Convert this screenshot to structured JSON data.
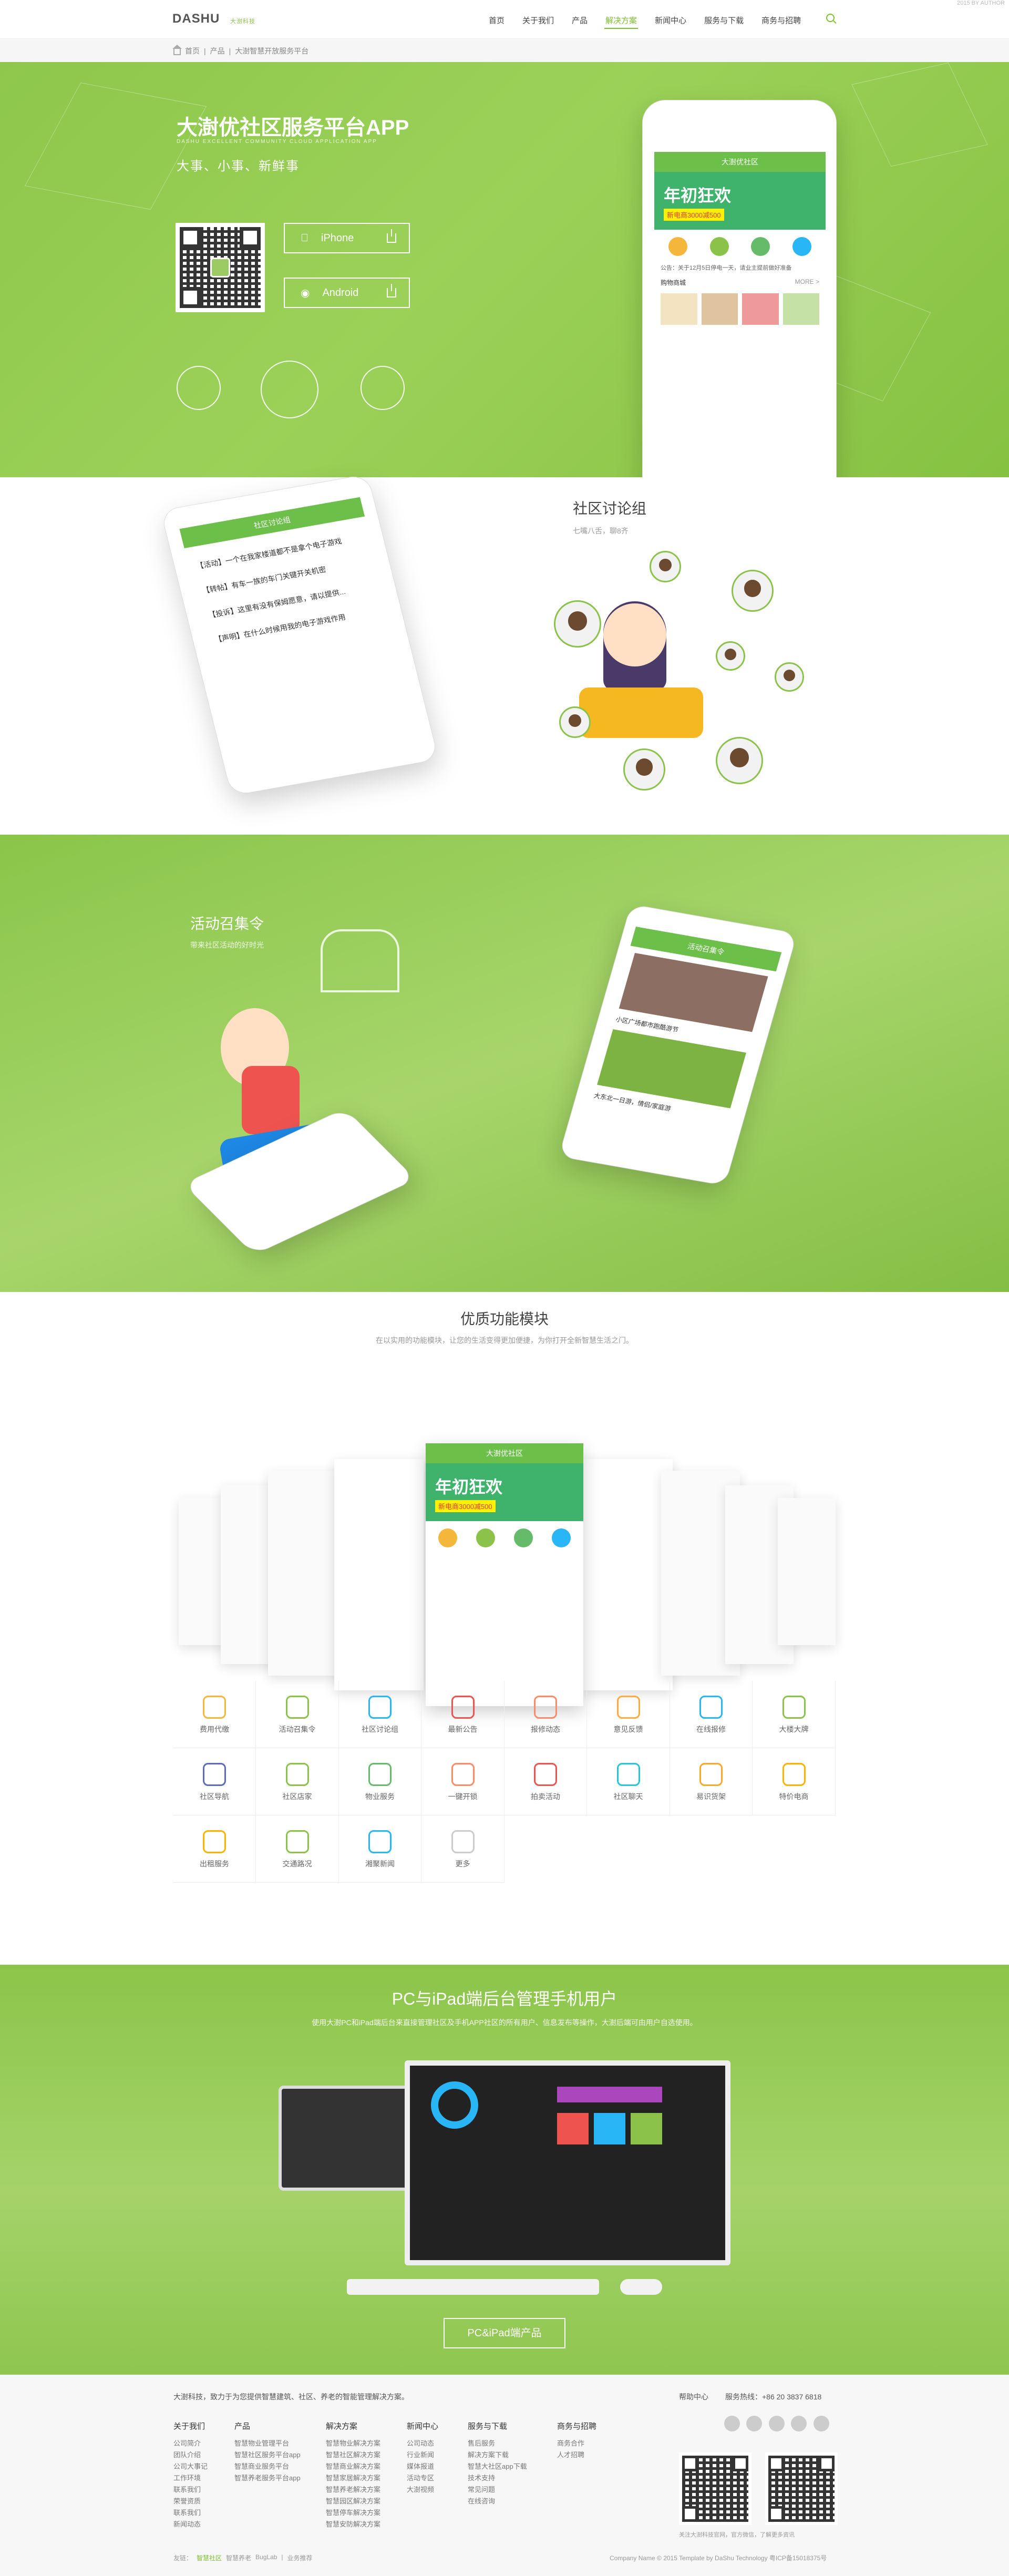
{
  "header": {
    "logo": "DASHU",
    "logo_sub": "DASHU",
    "logo_tag": "大澍科技",
    "nav": [
      "首页",
      "关于我们",
      "产品",
      "解决方案",
      "新闻中心",
      "服务与下载",
      "商务与招聘"
    ],
    "active_index": 3,
    "top_right": "2015 BY AUTHOR"
  },
  "breadcrumb": [
    "首页",
    "产品",
    "大澍智慧开放服务平台"
  ],
  "hero": {
    "title": "大澍优社区服务平台APP",
    "en": "DASHU EXCELLENT COMMUNITY CLOUD APPLICATION APP",
    "subtitle": "大事、小事、新鲜事",
    "iphone_label": "iPhone",
    "android_label": "Android",
    "phone": {
      "app_title": "大澍优社区",
      "banner_big": "年初狂欢",
      "banner_coupon": "新电商3000减500",
      "notice": "公告：关于12月5日停电一天，请业主提前做好准备",
      "shop_title": "购物商城",
      "more": "MORE >"
    }
  },
  "community": {
    "title": "社区讨论组",
    "subtitle": "七嘴八舌，聊8齐",
    "list_title": "社区讨论组",
    "posts": [
      "【活动】一个在我家楼道都不是拿个电子游戏",
      "【转帖】有车一族的车门关键开关机密",
      "【投诉】这里有没有保姆愿意，请以提供...",
      "【声明】在什么时候用我的电子游戏作用"
    ]
  },
  "activity": {
    "title": "活动召集令",
    "subtitle": "带来社区活动的好时光",
    "card_titles": [
      "小区广场都市跑酷游节",
      "大东北一日游，情侣/家庭游"
    ]
  },
  "modules": {
    "title": "优质功能模块",
    "subtitle": "在以实用的功能模块，让您的生活变得更加便捷，为你打开全新智慧生活之门。",
    "items": [
      {
        "label": "费用代缴",
        "icon": "coin-icon",
        "color": "#f5b73b"
      },
      {
        "label": "活动召集令",
        "icon": "flag-icon",
        "color": "#8bc34a"
      },
      {
        "label": "社区讨论组",
        "icon": "chat-icon",
        "color": "#29b6f6"
      },
      {
        "label": "最新公告",
        "icon": "megaphone-icon",
        "color": "#ef5350"
      },
      {
        "label": "报修动态",
        "icon": "eye-icon",
        "color": "#ff8a65"
      },
      {
        "label": "意见反馈",
        "icon": "mail-icon",
        "color": "#ffab40"
      },
      {
        "label": "在线报修",
        "icon": "tools-icon",
        "color": "#29b6f6"
      },
      {
        "label": "大楼大牌",
        "icon": "building-icon",
        "color": "#8bc34a"
      },
      {
        "label": "社区导航",
        "icon": "signpost-icon",
        "color": "#5c6bc0"
      },
      {
        "label": "社区店家",
        "icon": "shop-icon",
        "color": "#8bc34a"
      },
      {
        "label": "物业服务",
        "icon": "house-icon",
        "color": "#66bb6a"
      },
      {
        "label": "一键开锁",
        "icon": "hand-icon",
        "color": "#ff8a65"
      },
      {
        "label": "拍卖活动",
        "icon": "hammer-icon",
        "color": "#ef5350"
      },
      {
        "label": "社区聊天",
        "icon": "chat-bubbles-icon",
        "color": "#26c6da"
      },
      {
        "label": "易识货架",
        "icon": "bag-icon",
        "color": "#ffa726"
      },
      {
        "label": "特价电商",
        "icon": "cart-icon",
        "color": "#ffb300"
      },
      {
        "label": "出租服务",
        "icon": "bus-icon",
        "color": "#ffb300"
      },
      {
        "label": "交通路况",
        "icon": "traffic-light-icon",
        "color": "#8bc34a"
      },
      {
        "label": "湘聚新闻",
        "icon": "news-icon",
        "color": "#29b6f6"
      },
      {
        "label": "更多",
        "icon": "plus-icon",
        "color": "#cccccc"
      }
    ]
  },
  "management": {
    "title": "PC与iPad端后台管理手机用户",
    "subtitle": "使用大澍PC和iPad端后台来直接管理社区及手机APP社区的所有用户、信息发布等操作，大澍后端可由用户自选使用。",
    "button": "PC&iPad端产品"
  },
  "footer": {
    "intro": "大澍科技，致力于为您提供智慧建筑、社区、养老的智能管理解决方案。",
    "helpline_label": "帮助中心",
    "hotline": "服务热线：+86 20 3837 6818",
    "columns": [
      {
        "title": "关于我们",
        "links": [
          "公司简介",
          "团队介绍",
          "公司大事记",
          "工作环境",
          "联系我们",
          "荣誉资质",
          "联系我们",
          "新闻动态"
        ]
      },
      {
        "title": "产品",
        "links": [
          "智慧物业管理平台",
          "智慧社区服务平台app",
          "智慧商业服务平台",
          "智慧养老服务平台app"
        ]
      },
      {
        "title": "解决方案",
        "links": [
          "智慧物业解决方案",
          "智慧社区解决方案",
          "智慧商业解决方案",
          "智慧家居解决方案",
          "智慧养老解决方案",
          "智慧园区解决方案",
          "智慧停车解决方案",
          "智慧安防解决方案"
        ]
      },
      {
        "title": "新闻中心",
        "links": [
          "公司动态",
          "行业新闻",
          "媒体报道",
          "活动专区",
          "大澍视频"
        ]
      },
      {
        "title": "服务与下载",
        "links": [
          "售后服务",
          "解决方案下载",
          "智慧大社区app下载",
          "技术支持",
          "常见问题",
          "在线咨询"
        ]
      },
      {
        "title": "商务与招聘",
        "links": [
          "商务合作",
          "人才招聘"
        ]
      }
    ],
    "qr_caption": "关注大澍科技官网，官方微信，了解更多资讯",
    "friend_links": [
      "友链：",
      "智慧社区",
      "智慧养老",
      "BugLab",
      "|",
      "业务推荐"
    ],
    "copyright": "Company Name © 2015 Template by DaShu Technology 粤ICP备15018375号"
  }
}
